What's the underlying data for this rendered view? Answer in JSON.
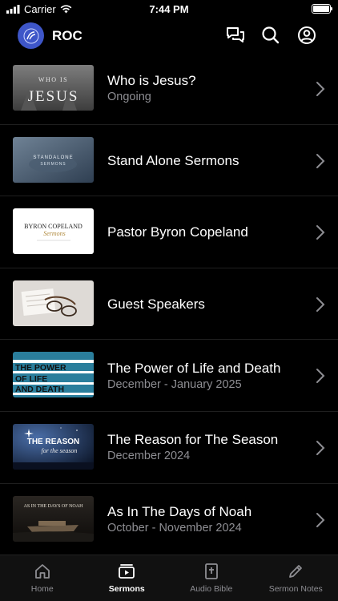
{
  "status_bar": {
    "carrier": "Carrier",
    "time": "7:44 PM"
  },
  "header": {
    "app_name": "ROC",
    "icons": [
      "chat-icon",
      "search-icon",
      "profile-icon"
    ]
  },
  "series": [
    {
      "title": "Who is Jesus?",
      "subtitle": "Ongoing",
      "thumb_text": [
        "WHO IS",
        "JESUS"
      ]
    },
    {
      "title": "Stand Alone Sermons",
      "subtitle": "",
      "thumb_text": [
        "STANDALONE",
        "SERMONS"
      ]
    },
    {
      "title": "Pastor Byron Copeland",
      "subtitle": "",
      "thumb_text": [
        "BYRON COPELAND",
        "Sermons"
      ]
    },
    {
      "title": "Guest Speakers",
      "subtitle": "",
      "thumb_text": []
    },
    {
      "title": "The Power of Life and Death",
      "subtitle": "December - January 2025",
      "thumb_text": [
        "THE POWER",
        "OF LIFE",
        "AND DEATH"
      ]
    },
    {
      "title": "The Reason for The Season",
      "subtitle": "December 2024",
      "thumb_text": [
        "THE REASON",
        "for the season"
      ]
    },
    {
      "title": "As In The Days of Noah",
      "subtitle": "October - November 2024",
      "thumb_text": [
        "AS IN THE DAYS OF NOAH"
      ]
    }
  ],
  "tab_bar": {
    "active": "Sermons",
    "tabs": [
      {
        "label": "Home",
        "icon": "home-icon"
      },
      {
        "label": "Sermons",
        "icon": "video-icon"
      },
      {
        "label": "Audio Bible",
        "icon": "bible-icon"
      },
      {
        "label": "Sermon Notes",
        "icon": "pencil-icon"
      }
    ]
  },
  "colors": {
    "background": "#000000",
    "logo": "#3e56c8",
    "subtitle": "#8e8e93"
  }
}
